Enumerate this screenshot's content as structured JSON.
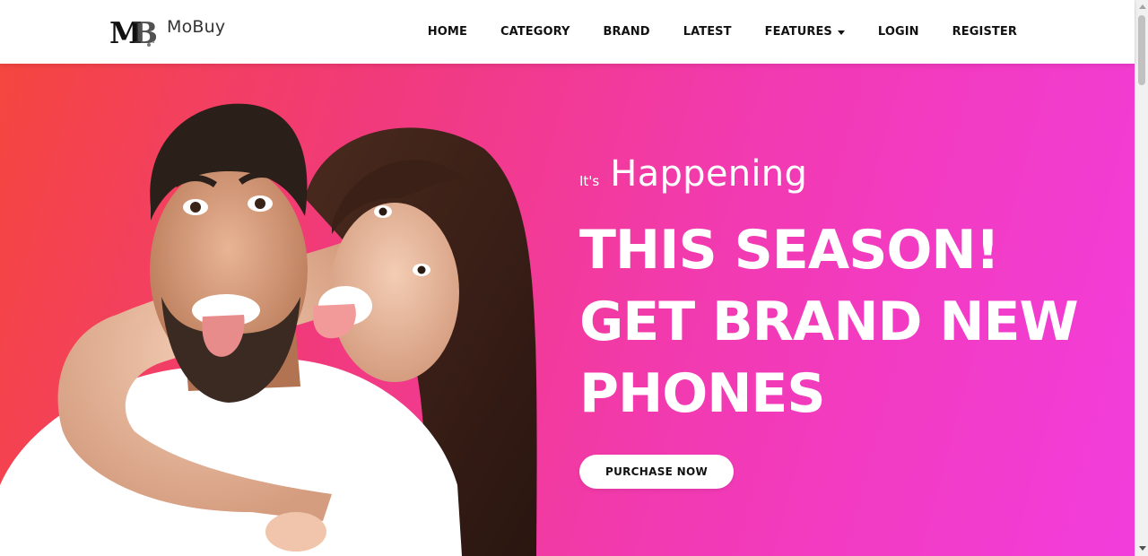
{
  "brand": {
    "logo_letters": "MB",
    "name": "MoBuy"
  },
  "nav": {
    "items": [
      {
        "label": "HOME"
      },
      {
        "label": "CATEGORY"
      },
      {
        "label": "BRAND"
      },
      {
        "label": "LATEST"
      },
      {
        "label": "FEATURES",
        "has_dropdown": true
      },
      {
        "label": "LOGIN"
      },
      {
        "label": "REGISTER"
      }
    ]
  },
  "hero": {
    "kicker_small": "It's",
    "kicker_big": "Happening",
    "headline_lines": [
      "THIS SEASON!",
      "GET BRAND NEW",
      "PHONES"
    ],
    "cta_label": "PURCHASE NOW",
    "image_description_icon": "couple-photo",
    "colors": {
      "gradient_start": "#f5463f",
      "gradient_mid": "#f13a7a",
      "gradient_end": "#f23ddc",
      "cta_background": "#ffffff",
      "cta_text": "#111111"
    }
  },
  "icons": {
    "dropdown": "caret-down-icon",
    "scroll_up": "scroll-up-icon",
    "scroll_down": "scroll-down-icon"
  }
}
